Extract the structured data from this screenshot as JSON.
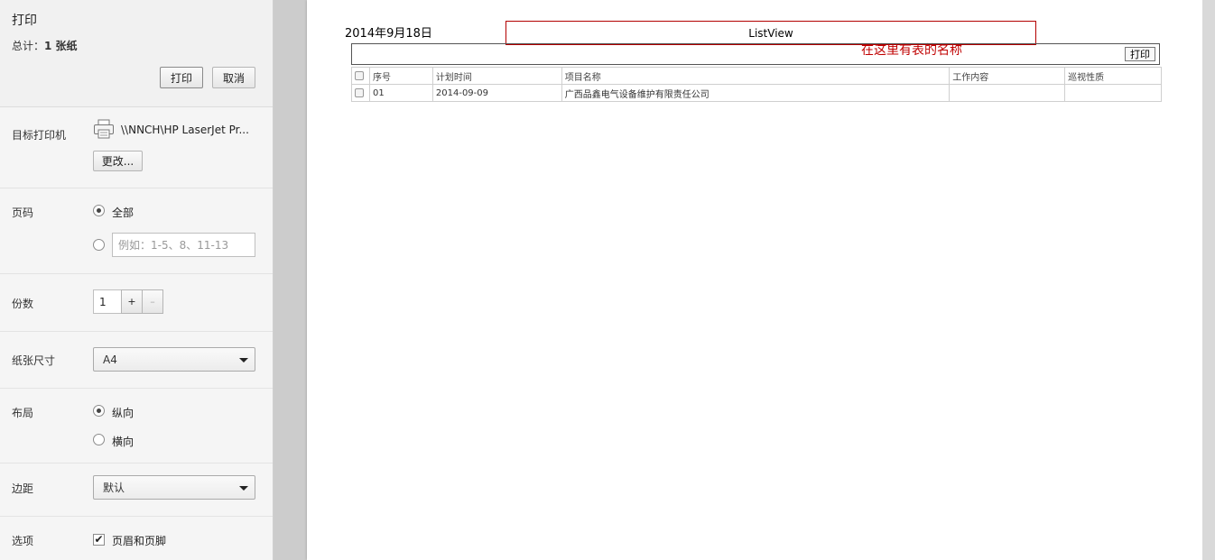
{
  "header": {
    "title": "打印",
    "summary_prefix": "总计：",
    "summary_value": "1 张纸",
    "print_label": "打印",
    "cancel_label": "取消"
  },
  "destination": {
    "label": "目标打印机",
    "printer_name": "\\\\NNCH\\HP LaserJet Pr...",
    "change_label": "更改..."
  },
  "pages": {
    "label": "页码",
    "all_label": "全部",
    "range_placeholder": "例如：1-5、8、11-13"
  },
  "copies": {
    "label": "份数",
    "value": "1",
    "plus": "+",
    "minus": "–"
  },
  "paper_size": {
    "label": "纸张尺寸",
    "selected": "A4"
  },
  "layout": {
    "label": "布局",
    "portrait": "纵向",
    "landscape": "横向"
  },
  "margins": {
    "label": "边距",
    "selected": "默认"
  },
  "options": {
    "label": "选项",
    "header_footer": "页眉和页脚",
    "check_mark": "✔"
  },
  "preview": {
    "date": "2014年9月18日",
    "title": "ListView",
    "note": "在这里有表的名称",
    "print_button": "打印",
    "columns": [
      "序号",
      "计划时间",
      "项目名称",
      "工作内容",
      "巡视性质"
    ],
    "rows": [
      [
        "01",
        "2014-09-09",
        "广西品鑫电气设备维护有限责任公司",
        "",
        ""
      ]
    ]
  }
}
